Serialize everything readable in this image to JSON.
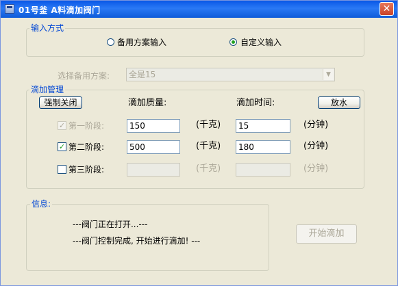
{
  "window": {
    "title": "01号釜 A料滴加阀门"
  },
  "input_mode": {
    "legend": "输入方式",
    "option_backup": "备用方案输入",
    "option_custom": "自定义输入",
    "selected": "custom"
  },
  "backup_plan": {
    "label": "选择备用方案:",
    "value": "全是15"
  },
  "drip": {
    "legend": "滴加管理",
    "force_close_label": "强制关闭",
    "mass_header": "滴加质量:",
    "time_header": "滴加时间:",
    "drain_label": "放水",
    "stages": [
      {
        "label": "第一阶段:",
        "checked": true,
        "enabled": false,
        "mass": "150",
        "mass_unit": "(千克)",
        "time": "15",
        "time_unit": "(分钟)"
      },
      {
        "label": "第二阶段:",
        "checked": true,
        "enabled": true,
        "mass": "500",
        "mass_unit": "(千克)",
        "time": "180",
        "time_unit": "(分钟)"
      },
      {
        "label": "第三阶段:",
        "checked": false,
        "enabled": true,
        "mass": "",
        "mass_unit": "(千克)",
        "time": "",
        "time_unit": "(分钟)"
      }
    ]
  },
  "info": {
    "legend": "信息:",
    "lines": [
      "---阀门正在打开...---",
      "---阀门控制完成, 开始进行滴加! ---"
    ]
  },
  "start_button_label": "开始滴加",
  "colors": {
    "title_bar": "#0A58E6",
    "window_bg": "#ECE9D8",
    "legend_text": "#0046D5",
    "check_green": "#21A121",
    "disabled_text": "#ACA899"
  }
}
